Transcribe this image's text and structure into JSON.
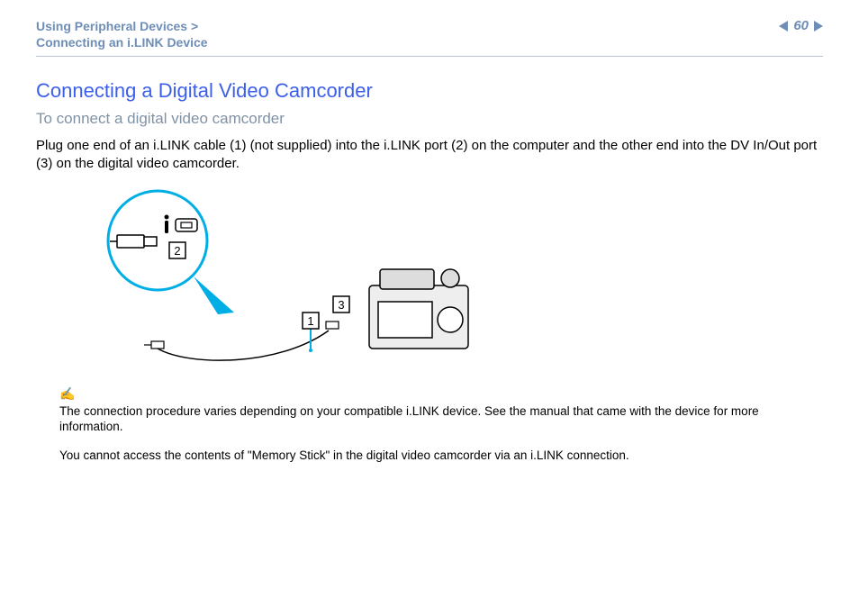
{
  "header": {
    "breadcrumb_line1": "Using Peripheral Devices >",
    "breadcrumb_line2": "Connecting an i.LINK Device",
    "page_number": "60"
  },
  "content": {
    "title": "Connecting a Digital Video Camcorder",
    "subtitle": "To connect a digital video camcorder",
    "body": "Plug one end of an i.LINK cable (1) (not supplied) into the i.LINK port (2) on the computer and the other end into the DV In/Out port (3) on the digital video camcorder."
  },
  "diagram": {
    "callout_1": "1",
    "callout_2": "2",
    "callout_3": "3"
  },
  "notes": {
    "line1": "The connection procedure varies depending on your compatible i.LINK device. See the manual that came with the device for more information.",
    "line2": "You cannot access the contents of \"Memory Stick\" in the digital video camcorder via an i.LINK connection."
  }
}
